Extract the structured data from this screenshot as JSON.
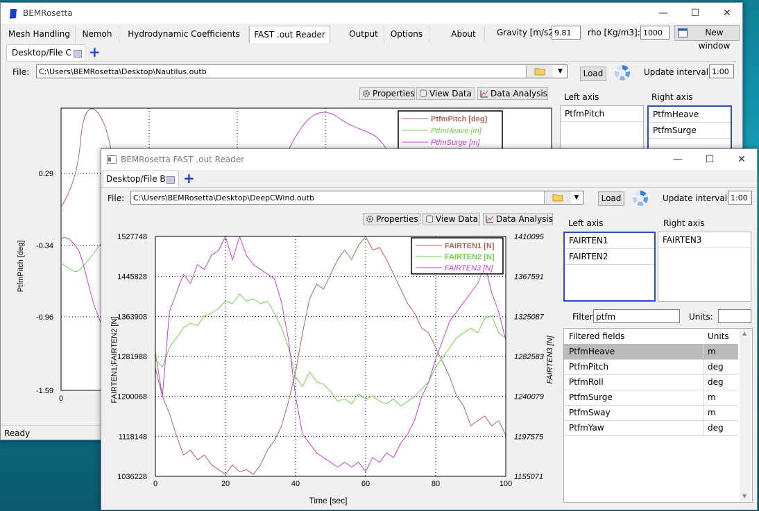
{
  "back_window": {
    "title": "BEMRosetta",
    "menu_tabs": [
      "Mesh Handling",
      "Nemoh",
      "Hydrodynamic Coefficients",
      "FAST .out Reader",
      "Output",
      "Options",
      "About"
    ],
    "gravity_label": "Gravity [m/s2]:",
    "gravity_value": "9.81",
    "rho_label": "rho [Kg/m3]:",
    "rho_value": "1000",
    "new_window_label": "New window",
    "doc_tab": "Desktop/File C",
    "file_label": "File:",
    "file_path": "C:\\Users\\BEMRosetta\\Desktop\\Nautilus.outb",
    "load_label": "Load",
    "update_label": "Update interval:",
    "update_value": "1:00",
    "toolbar": {
      "properties": "Properties",
      "view_data": "View Data",
      "data_analysis": "Data Analysis"
    },
    "left_axis_title": "Left axis",
    "right_axis_title": "Right axis",
    "left_axis_items": [
      "PtfmPitch"
    ],
    "right_axis_items": [
      "PtfmHeave",
      "PtfmSurge"
    ],
    "status": "Ready",
    "chart": {
      "ylabel": "PtfmPitch [deg]",
      "yticks": [
        "0.29",
        "-0.34",
        "-0.96",
        "-1.59"
      ],
      "xticks": [
        "0"
      ],
      "legend": [
        {
          "name": "PtfmPitch [deg]",
          "color": "#b0645a"
        },
        {
          "name": "PtfmHeave [m]",
          "color": "#6fcf4a"
        },
        {
          "name": "PtfmSurge [m]",
          "color": "#c040d0"
        }
      ]
    }
  },
  "front_window": {
    "title": "BEMRosetta FAST .out Reader",
    "doc_tab": "Desktop/File B",
    "file_label": "File:",
    "file_path": "C:\\Users\\BEMRosetta\\Desktop\\DeepCWind.outb",
    "load_label": "Load",
    "update_label": "Update interval:",
    "update_value": "1:00",
    "toolbar": {
      "properties": "Properties",
      "view_data": "View Data",
      "data_analysis": "Data Analysis"
    },
    "left_axis_title": "Left axis",
    "right_axis_title": "Right axis",
    "left_axis_items": [
      "FAIRTEN1",
      "FAIRTEN2"
    ],
    "right_axis_items": [
      "FAIRTEN3"
    ],
    "filter_label": "Filter:",
    "filter_value": "ptfm",
    "units_label": "Units:",
    "units_value": "",
    "table_headers": [
      "Filtered fields",
      "Units"
    ],
    "table_rows": [
      {
        "field": "PtfmHeave",
        "unit": "m"
      },
      {
        "field": "PtfmPitch",
        "unit": "deg"
      },
      {
        "field": "PtfmRoll",
        "unit": "deg"
      },
      {
        "field": "PtfmSurge",
        "unit": "m"
      },
      {
        "field": "PtfmSway",
        "unit": "m"
      },
      {
        "field": "PtfmYaw",
        "unit": "deg"
      }
    ],
    "selected_row": 0
  },
  "chart_data": {
    "type": "line",
    "xlabel": "Time [sec]",
    "ylabel_left": "FAIRTEN1;FAIRTEN2 [N]",
    "ylabel_right": "FAIRTEN3 [N]",
    "xlim": [
      0,
      100
    ],
    "ylim_left": [
      1036228,
      1527748
    ],
    "ylim_right": [
      1155071,
      1410095
    ],
    "xticks": [
      0,
      20,
      40,
      60,
      80,
      100
    ],
    "yticks_left": [
      1036228,
      1118148,
      1200068,
      1281988,
      1363908,
      1445828,
      1527748
    ],
    "yticks_right": [
      1155071,
      1197575,
      1240079,
      1282583,
      1325087,
      1367591,
      1410095
    ],
    "grid": true,
    "legend_position": "top-right",
    "series": [
      {
        "name": "FAIRTEN1 [N]",
        "axis": "left",
        "color": "#b0645a",
        "x": [
          0,
          2,
          4,
          6,
          8,
          10,
          12,
          14,
          16,
          18,
          20,
          22,
          24,
          26,
          28,
          30,
          32,
          34,
          36,
          38,
          40,
          42,
          44,
          46,
          48,
          50,
          52,
          54,
          56,
          58,
          60,
          62,
          64,
          66,
          68,
          70,
          72,
          74,
          76,
          78,
          80,
          82,
          84,
          86,
          88,
          90,
          92,
          94,
          96,
          98,
          100
        ],
        "y": [
          1290000,
          1200000,
          1165000,
          1120000,
          1080000,
          1090000,
          1070000,
          1080000,
          1060000,
          1050000,
          1040000,
          1060000,
          1045000,
          1050000,
          1040000,
          1060000,
          1090000,
          1110000,
          1140000,
          1190000,
          1250000,
          1330000,
          1400000,
          1430000,
          1420000,
          1450000,
          1480000,
          1500000,
          1480000,
          1510000,
          1530000,
          1500000,
          1505000,
          1480000,
          1450000,
          1420000,
          1390000,
          1370000,
          1340000,
          1330000,
          1300000,
          1270000,
          1240000,
          1200000,
          1180000,
          1140000,
          1150000,
          1160000,
          1140000,
          1150000,
          1120000
        ]
      },
      {
        "name": "FAIRTEN2 [N]",
        "axis": "left",
        "color": "#6fcf4a",
        "x": [
          0,
          2,
          4,
          6,
          8,
          10,
          12,
          14,
          16,
          18,
          20,
          22,
          24,
          26,
          28,
          30,
          32,
          34,
          36,
          38,
          40,
          42,
          44,
          46,
          48,
          50,
          52,
          54,
          56,
          58,
          60,
          62,
          64,
          66,
          68,
          70,
          72,
          74,
          76,
          78,
          80,
          82,
          84,
          86,
          88,
          90,
          92,
          94,
          96,
          98,
          100
        ],
        "y": [
          1275000,
          1260000,
          1300000,
          1320000,
          1340000,
          1350000,
          1345000,
          1365000,
          1370000,
          1380000,
          1395000,
          1390000,
          1410000,
          1395000,
          1400000,
          1390000,
          1395000,
          1370000,
          1340000,
          1300000,
          1240000,
          1220000,
          1250000,
          1230000,
          1225000,
          1210000,
          1190000,
          1195000,
          1185000,
          1205000,
          1195000,
          1200000,
          1190000,
          1185000,
          1195000,
          1180000,
          1190000,
          1200000,
          1215000,
          1230000,
          1260000,
          1280000,
          1300000,
          1320000,
          1330000,
          1340000,
          1330000,
          1360000,
          1365000,
          1330000,
          1320000
        ]
      },
      {
        "name": "FAIRTEN3 [N]",
        "axis": "right",
        "color": "#c040d0",
        "x": [
          0,
          2,
          4,
          6,
          8,
          10,
          12,
          14,
          16,
          18,
          20,
          22,
          24,
          26,
          28,
          30,
          32,
          34,
          36,
          38,
          40,
          42,
          44,
          46,
          48,
          50,
          52,
          54,
          56,
          58,
          60,
          62,
          64,
          66,
          68,
          70,
          72,
          74,
          76,
          78,
          80,
          82,
          84,
          86,
          88,
          90,
          92,
          94,
          96,
          98,
          100
        ],
        "y": [
          1270000,
          1240000,
          1330000,
          1350000,
          1370000,
          1360000,
          1380000,
          1375000,
          1390000,
          1395000,
          1410000,
          1385000,
          1410000,
          1390000,
          1380000,
          1375000,
          1370000,
          1365000,
          1340000,
          1300000,
          1240000,
          1200000,
          1190000,
          1180000,
          1175000,
          1170000,
          1165000,
          1170000,
          1165000,
          1170000,
          1160000,
          1175000,
          1170000,
          1180000,
          1175000,
          1190000,
          1200000,
          1215000,
          1240000,
          1255000,
          1280000,
          1300000,
          1320000,
          1330000,
          1340000,
          1350000,
          1360000,
          1380000,
          1350000,
          1330000,
          1300000
        ]
      }
    ]
  }
}
